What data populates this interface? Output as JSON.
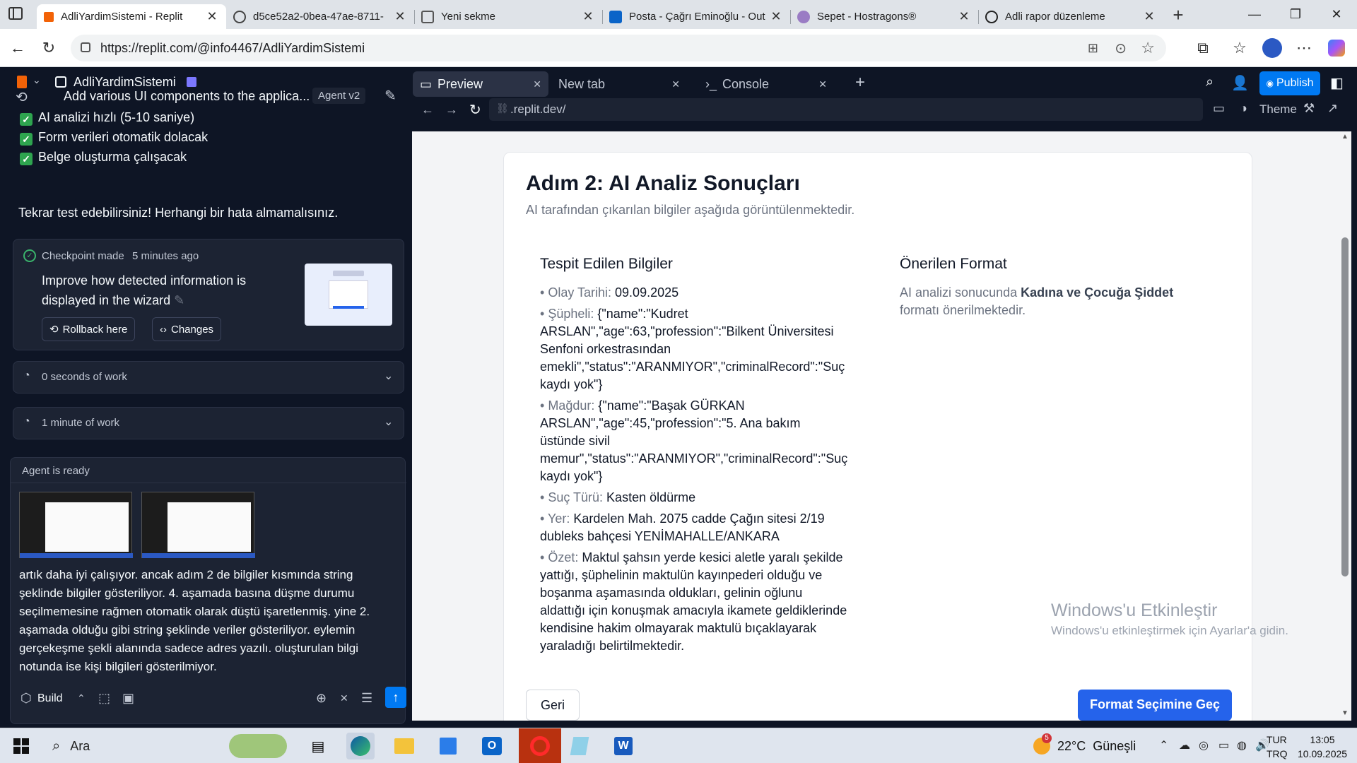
{
  "browser": {
    "tabs": [
      {
        "title": "AdliYardimSistemi - Replit",
        "active": true
      },
      {
        "title": "d5ce52a2-0bea-47ae-8711-"
      },
      {
        "title": "Yeni sekme"
      },
      {
        "title": "Posta - Çağrı Eminoğlu - Out"
      },
      {
        "title": "Sepet - Hostragons®"
      },
      {
        "title": "Adli rapor düzenleme"
      }
    ],
    "url": "https://replit.com/@info4467/AdliYardimSistemi"
  },
  "replit": {
    "project_name": "AdliYardimSistemi",
    "thread_title": "Add various UI components to the applica...",
    "agent_badge": "Agent v2",
    "checklist": [
      "AI analizi hızlı (5-10 saniye)",
      "Form verileri otomatik dolacak",
      "Belge oluşturma çalışacak"
    ],
    "message": "Tekrar test edebilirsiniz! Herhangi bir hata almamalısınız.",
    "checkpoint": {
      "label": "Checkpoint made",
      "time": "5 minutes ago",
      "description_line1": "Improve how detected information is",
      "description_line2": "displayed in the wizard",
      "rollback_label": "Rollback here",
      "changes_label": "Changes"
    },
    "work_items": [
      "0 seconds of work",
      "1 minute of work"
    ],
    "agent_status": "Agent is ready",
    "user_message": [
      "artık daha iyi çalışıyor. ancak adım 2 de bilgiler kısmında string",
      "şeklinde bilgiler gösteriliyor. 4. aşamada basına düşme durumu",
      "seçilmemesine rağmen otomatik olarak düştü işaretlenmiş. yine 2.",
      "aşamada olduğu gibi string şeklinde veriler gösteriliyor. eylemin",
      "gerçekeşme şekli alanında sadece adres yazılı. oluşturulan bilgi",
      "notunda ise kişi bilgileri gösterilmiyor."
    ],
    "build_label": "Build",
    "pane_tabs": [
      "Preview",
      "New tab",
      "Console"
    ],
    "publish_label": "Publish",
    "preview_url": ".replit.dev/",
    "theme_label": "Theme"
  },
  "preview": {
    "title": "Adım 2: AI Analiz Sonuçları",
    "subtitle": "AI tarafından çıkarılan bilgiler aşağıda görüntülenmektedir.",
    "detected_heading": "Tespit Edilen Bilgiler",
    "fields": [
      {
        "label": "Olay Tarihi:",
        "lines": [
          "09.09.2025"
        ]
      },
      {
        "label": "Şüpheli:",
        "lines": [
          "{\"name\":\"Kudret",
          "ARSLAN\",\"age\":63,\"profession\":\"Bilkent Üniversitesi",
          "Senfoni orkestrasından",
          "emekli\",\"status\":\"ARANMIYOR\",\"criminalRecord\":\"Suç",
          "kaydı yok\"}"
        ]
      },
      {
        "label": "Mağdur:",
        "lines": [
          "{\"name\":\"Başak GÜRKAN",
          "ARSLAN\",\"age\":45,\"profession\":\"5. Ana bakım",
          "üstünde sivil",
          "memur\",\"status\":\"ARANMIYOR\",\"criminalRecord\":\"Suç",
          "kaydı yok\"}"
        ]
      },
      {
        "label": "Suç Türü:",
        "lines": [
          "Kasten öldürme"
        ]
      },
      {
        "label": "Yer:",
        "lines": [
          "Kardelen Mah. 2075 cadde Çağın sitesi 2/19",
          "dubleks bahçesi YENİMAHALLE/ANKARA"
        ]
      },
      {
        "label": "Özet:",
        "lines": [
          "Maktul şahsın yerde kesici aletle yaralı şekilde",
          "yattığı, şüphelinin maktulün kayınpederi olduğu ve",
          "boşanma aşamasında oldukları, gelinin oğlunu",
          "aldattığı için konuşmak amacıyla ikamete geldiklerinde",
          "kendisine hakim olmayarak maktulü bıçaklayarak",
          "yaraladığı belirtilmektedir."
        ]
      }
    ],
    "suggested_heading": "Önerilen Format",
    "suggested_prefix": "AI analizi sonucunda",
    "suggested_format": "Kadına ve Çocuğa Şiddet",
    "suggested_suffix": "formatı önerilmektedir.",
    "back_label": "Geri",
    "next_label": "Format Seçimine Geç",
    "watermark_title": "Windows'u Etkinleştir",
    "watermark_sub": "Windows'u etkinleştirmek için Ayarlar'a gidin."
  },
  "taskbar": {
    "search_placeholder": "Ara",
    "weather": "22°C  Güneşli",
    "weather_badge": "5",
    "lang": "TUR",
    "lang2": "TRQ",
    "time": "13:05",
    "date": "10.09.2025"
  }
}
